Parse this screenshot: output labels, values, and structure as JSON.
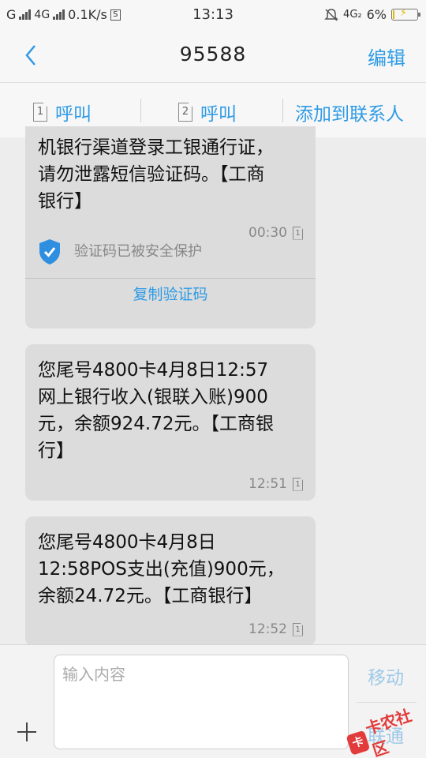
{
  "status_bar": {
    "sim1_label": "G",
    "sim2_label": "4G",
    "speed": "0.1K/s",
    "box_icon_label": "S",
    "time": "13:13",
    "network_right": "4G₂",
    "battery_percent": "6%",
    "battery_level": 0.06
  },
  "header": {
    "title": "95588",
    "edit_label": "编辑"
  },
  "actions": {
    "call1_sim": "1",
    "call1_label": "呼叫",
    "call2_sim": "2",
    "call2_label": "呼叫",
    "add_contact_label": "添加到联系人"
  },
  "messages": [
    {
      "text": "机银行渠道登录工银通行证，\n请勿泄露短信验证码。【工商\n银行】",
      "time": "00:30",
      "sim": "1",
      "security_note": "验证码已被安全保护",
      "copy_label": "复制验证码"
    },
    {
      "text": "您尾号4800卡4月8日12:57\n网上银行收入(银联入账)900\n元，余额924.72元。【工商银\n行】",
      "time": "12:51",
      "sim": "1"
    },
    {
      "text": "您尾号4800卡4月8日\n12:58POS支出(充值)900元，\n余额24.72元。【工商银行】",
      "time": "12:52",
      "sim": "1"
    }
  ],
  "composer": {
    "placeholder": "输入内容",
    "send_sim1_label": "移动",
    "send_sim2_label": "联通"
  },
  "watermark": {
    "text": "卡农社区",
    "logo_char": "卡"
  },
  "colors": {
    "accent": "#2e9be6",
    "bubble": "#dcdcdc",
    "shield": "#2e8fe0",
    "watermark": "#e23b3b"
  }
}
